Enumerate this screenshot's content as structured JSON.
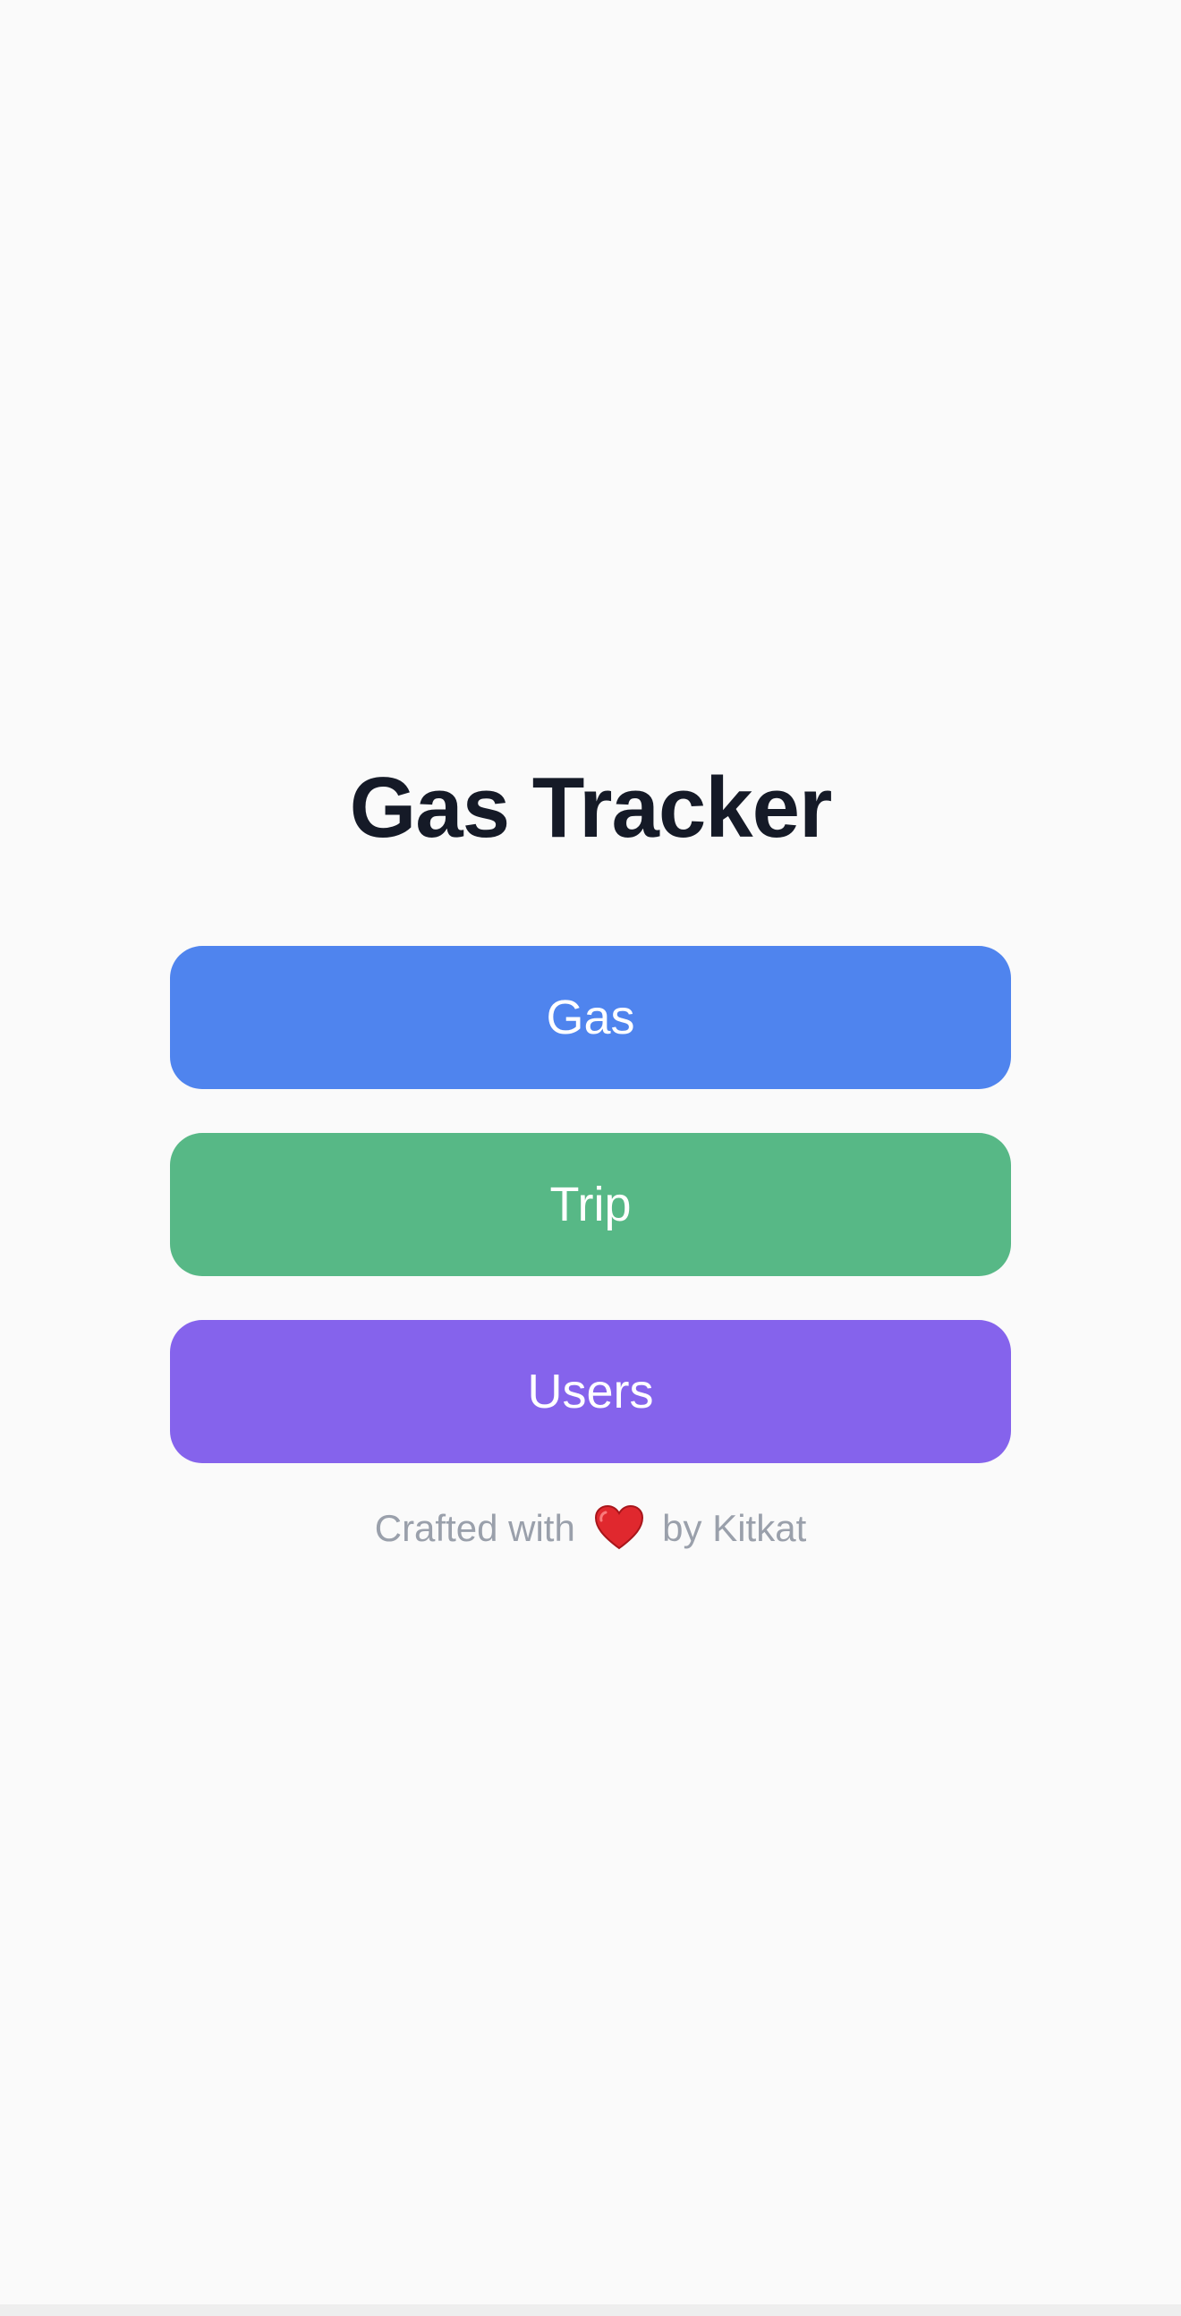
{
  "app": {
    "title": "Gas Tracker"
  },
  "buttons": [
    {
      "label": "Gas",
      "color": "#4f84ee"
    },
    {
      "label": "Trip",
      "color": "#57b886"
    },
    {
      "label": "Users",
      "color": "#8563ec"
    }
  ],
  "footer": {
    "prefix": "Crafted with",
    "icon": "heart-icon",
    "suffix": "by Kitkat",
    "heart_color": "#e0282e"
  }
}
